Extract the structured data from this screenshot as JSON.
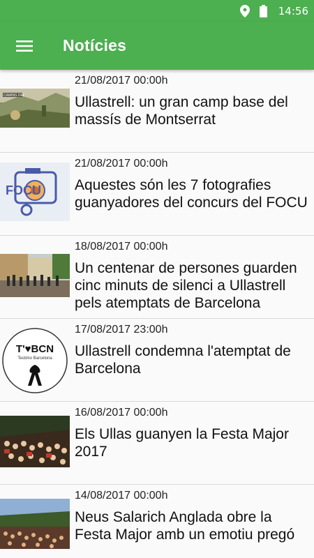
{
  "status": {
    "time": "14:56"
  },
  "toolbar": {
    "title": "Notícies"
  },
  "news": [
    {
      "date": "21/08/2017 00:00h",
      "title": "Ullastrell: un gran camp base del massís de Montserrat"
    },
    {
      "date": "21/08/2017 00:00h",
      "title": "Aquestes són les 7 fotografies guanyadores del concurs del FOCU"
    },
    {
      "date": "18/08/2017 00:00h",
      "title": "Un centenar de persones guarden cinc minuts de silenci a Ullastrell pels atemptats de Barcelona"
    },
    {
      "date": "17/08/2017 23:00h",
      "title": "Ullastrell condemna l'atemptat de Barcelona"
    },
    {
      "date": "16/08/2017 00:00h",
      "title": "Els Ullas guanyen la Festa Major 2017"
    },
    {
      "date": "14/08/2017 00:00h",
      "title": "Neus Salarich Anglada obre la Festa Major amb un emotiu pregó"
    }
  ],
  "images": {
    "camp_base_caption": "CAMINS DEL",
    "focu_text": "FOCU",
    "tbcn_logo": "T'♥BCN",
    "tbcn_subtitle": "Testimo Barcelona"
  },
  "colors": {
    "primary": "#4caf50"
  }
}
